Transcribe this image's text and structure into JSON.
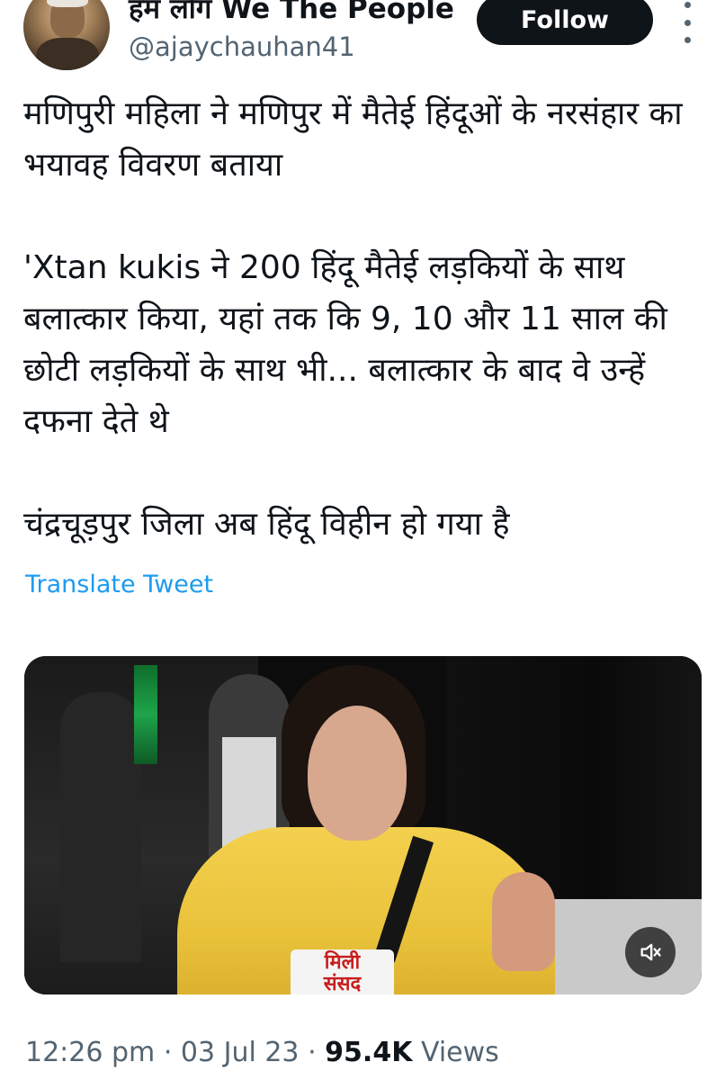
{
  "author": {
    "display_name": "हम लोग We The People",
    "handle": "@ajaychauhan41",
    "follow_label": "Follow"
  },
  "tweet": {
    "line1": "मणिपुरी महिला ने मणिपुर में मैतेई हिंदूओं के नरसंहार का भयावह विवरण बताया",
    "line2": "'Xtan kukis ने 200 हिंदू मैतेई लड़कियों के साथ बलात्कार किया, यहां तक कि 9, 10 और 11 साल की छोटी लड़कियों के साथ भी... बलात्कार के बाद वे उन्हें दफना देते थे",
    "line3": "चंद्रचूड़पुर जिला अब हिंदू विहीन हो गया है",
    "translate_label": "Translate Tweet"
  },
  "media": {
    "caption_line1": "मिली",
    "caption_line2": "संसद",
    "sound_icon": "speaker-muted-icon"
  },
  "meta": {
    "time": "12:26 pm",
    "date": "03 Jul 23",
    "views_count": "95.4K",
    "views_label": "Views",
    "separator": "·"
  },
  "colors": {
    "text": "#0f1419",
    "secondary": "#536471",
    "link": "#1d9bf0",
    "button_bg": "#0f1419"
  }
}
